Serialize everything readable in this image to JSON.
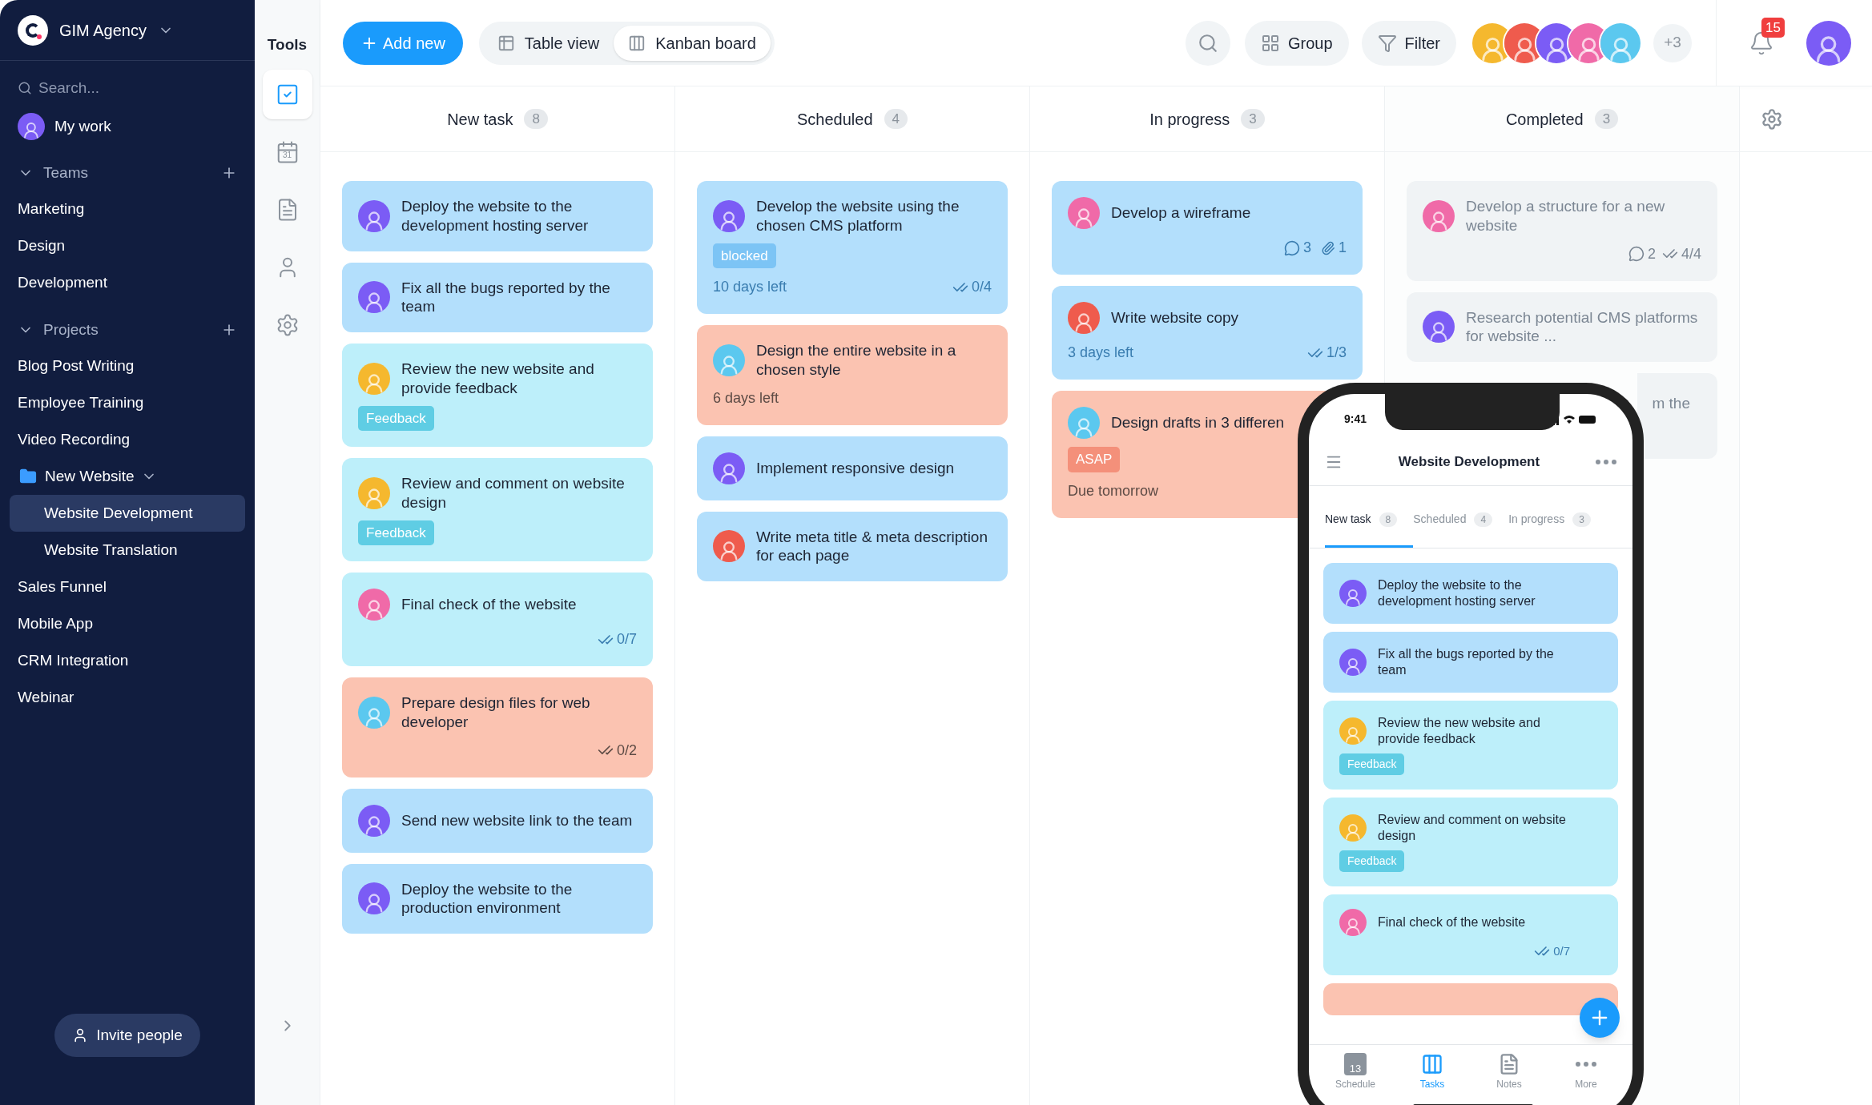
{
  "sidebar": {
    "workspace": "GIM Agency",
    "search_placeholder": "Search...",
    "items": [
      {
        "kind": "avatar",
        "label": "My work",
        "selected": false,
        "color": "#7b5cf5"
      },
      {
        "kind": "section",
        "label": "Teams",
        "expanded": true,
        "children": [
          {
            "kind": "item",
            "label": "Marketing",
            "selected": false
          },
          {
            "kind": "item",
            "label": "Design",
            "selected": false
          },
          {
            "kind": "item",
            "label": "Development",
            "selected": false
          }
        ]
      },
      {
        "kind": "section",
        "label": "Projects",
        "expanded": true,
        "children": [
          {
            "kind": "item",
            "label": "Blog Post Writing",
            "selected": false
          },
          {
            "kind": "item",
            "label": "Employee Training",
            "selected": false
          },
          {
            "kind": "item",
            "label": "Video Recording",
            "selected": false
          },
          {
            "kind": "folder",
            "label": "New Website",
            "selected": false,
            "expanded": true,
            "children": [
              {
                "kind": "item",
                "label": "Website Development",
                "selected": true
              },
              {
                "kind": "item",
                "label": "Website Translation",
                "selected": false
              }
            ]
          },
          {
            "kind": "item",
            "label": "Sales Funnel",
            "selected": false
          },
          {
            "kind": "item",
            "label": "Mobile App",
            "selected": false
          },
          {
            "kind": "item",
            "label": "CRM Integration",
            "selected": false
          },
          {
            "kind": "item",
            "label": "Webinar",
            "selected": false
          }
        ]
      }
    ],
    "invite": "Invite people"
  },
  "tools": {
    "title": "Tools",
    "items": [
      {
        "kind": "tasks",
        "selected": true
      },
      {
        "kind": "calendar",
        "selected": false,
        "label": "31"
      },
      {
        "kind": "notes",
        "selected": false
      },
      {
        "kind": "people",
        "selected": false
      },
      {
        "kind": "settings",
        "selected": false
      }
    ]
  },
  "toolbar": {
    "add": "Add new",
    "views": [
      {
        "kind": "table",
        "label": "Table view",
        "selected": false
      },
      {
        "kind": "kanban",
        "label": "Kanban board",
        "selected": true
      }
    ],
    "group": "Group",
    "filter": "Filter",
    "members": [
      {
        "color": "#f5b82e"
      },
      {
        "color": "#ef5b4d"
      },
      {
        "color": "#7b5cf5"
      },
      {
        "color": "#f06aa8"
      },
      {
        "color": "#5bc8ef"
      }
    ],
    "more_members": "+3",
    "notifications": "15",
    "user": {
      "color": "#7b5cf5"
    }
  },
  "columns": [
    {
      "title": "New task",
      "count": "8",
      "muted": false,
      "cards": [
        {
          "title": "Deploy the website to the development hosting server",
          "color": "#b3dffc",
          "avatar": {
            "color": "#7b5cf5"
          }
        },
        {
          "title": "Fix all the bugs reported by the team",
          "color": "#b3dffc",
          "avatar": {
            "color": "#7b5cf5"
          }
        },
        {
          "title": "Review the new website and provide feedback",
          "color": "#bdeffa",
          "avatar": {
            "color": "#f5b82e"
          },
          "tag": {
            "label": "Feedback",
            "color": "#5fcde4"
          }
        },
        {
          "title": "Review and comment on website design",
          "color": "#bdeffa",
          "avatar": {
            "color": "#f5b82e"
          },
          "tag": {
            "label": "Feedback",
            "color": "#5fcde4"
          }
        },
        {
          "title": "Final check of the website",
          "color": "#bdeffa",
          "avatar": {
            "color": "#f06aa8"
          },
          "checks": "0/7"
        },
        {
          "title": "Prepare design files for web developer",
          "color": "#fbc3b1",
          "avatar": {
            "color": "#5bc8ef"
          },
          "checks": "0/2"
        },
        {
          "title": "Send new website link to the team",
          "color": "#b3dffc",
          "avatar": {
            "color": "#7b5cf5"
          }
        },
        {
          "title": "Deploy the website to the production environment",
          "color": "#b3dffc",
          "avatar": {
            "color": "#7b5cf5"
          }
        }
      ]
    },
    {
      "title": "Scheduled",
      "count": "4",
      "muted": false,
      "cards": [
        {
          "title": "Develop the website using the chosen CMS platform",
          "color": "#b3dffc",
          "avatar": {
            "color": "#7b5cf5"
          },
          "tag": {
            "label": "blocked",
            "color": "#7cc4f5"
          },
          "due": "10 days left",
          "checks": "0/4"
        },
        {
          "title": "Design the entire website in a chosen style",
          "color": "#fbc3b1",
          "avatar": {
            "color": "#5bc8ef"
          },
          "due": "6 days left"
        },
        {
          "title": "Implement responsive design",
          "color": "#b3dffc",
          "avatar": {
            "color": "#7b5cf5"
          }
        },
        {
          "title": "Write meta title & meta description for each page",
          "color": "#b3dffc",
          "avatar": {
            "color": "#ef5b4d"
          }
        }
      ]
    },
    {
      "title": "In progress",
      "count": "3",
      "muted": false,
      "cards": [
        {
          "title": "Develop a wireframe",
          "color": "#b3dffc",
          "avatar": {
            "color": "#f06aa8"
          },
          "comments": "3",
          "attachments": "1"
        },
        {
          "title": "Write website copy",
          "color": "#b3dffc",
          "avatar": {
            "color": "#ef5b4d"
          },
          "due": "3 days left",
          "checks": "1/3"
        },
        {
          "title": "Design drafts in 3 differen",
          "color": "#fbc3b1",
          "avatar": {
            "color": "#5bc8ef"
          },
          "tag": {
            "label": "ASAP",
            "color": "#f4907a"
          },
          "due": "Due tomorrow"
        }
      ]
    },
    {
      "title": "Completed",
      "count": "3",
      "muted": true,
      "cards": [
        {
          "kind": "task",
          "title": "Develop a structure for a new website",
          "color": "#f0f3f5",
          "avatar": {
            "color": "#f06aa8"
          },
          "comments": "2",
          "checks": "4/4"
        },
        {
          "kind": "task",
          "title": "Research potential CMS platforms for website ...",
          "color": "#f0f3f5",
          "avatar": {
            "color": "#7b5cf5"
          }
        },
        {
          "kind": "covered",
          "title": "m the",
          "color": "#f0f3f5"
        }
      ]
    }
  ],
  "phone": {
    "time": "9:41",
    "title": "Website Development",
    "tabs": [
      {
        "label": "New task",
        "count": "8",
        "selected": true
      },
      {
        "label": "Scheduled",
        "count": "4",
        "selected": false
      },
      {
        "label": "In progress",
        "count": "3",
        "selected": false
      }
    ],
    "cards": [
      {
        "title": "Deploy the website to the development hosting server",
        "color": "#b3dffc",
        "avatar": {
          "color": "#7b5cf5"
        }
      },
      {
        "title": "Fix all the bugs reported by the team",
        "color": "#b3dffc",
        "avatar": {
          "color": "#7b5cf5"
        }
      },
      {
        "title": "Review the new website and provide feedback",
        "color": "#bdeffa",
        "avatar": {
          "color": "#f5b82e"
        },
        "tag": {
          "label": "Feedback",
          "color": "#5fcde4"
        }
      },
      {
        "title": "Review and comment on website design",
        "color": "#bdeffa",
        "avatar": {
          "color": "#f5b82e"
        },
        "tag": {
          "label": "Feedback",
          "color": "#5fcde4"
        }
      },
      {
        "title": "Final check of the website",
        "color": "#bdeffa",
        "avatar": {
          "color": "#f06aa8"
        },
        "checks": "0/7"
      }
    ],
    "nav": [
      {
        "kind": "schedule",
        "label": "Schedule",
        "icon_text": "13",
        "selected": false
      },
      {
        "kind": "tasks",
        "label": "Tasks",
        "selected": true
      },
      {
        "kind": "notes",
        "label": "Notes",
        "selected": false
      },
      {
        "kind": "more",
        "label": "More",
        "selected": false
      }
    ]
  }
}
